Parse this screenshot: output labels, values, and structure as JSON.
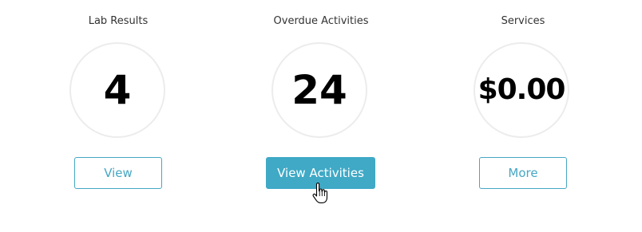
{
  "cards": [
    {
      "label": "Lab Results",
      "value": "4",
      "button_label": "View"
    },
    {
      "label": "Overdue Activities",
      "value": "24",
      "button_label": "View Activities"
    },
    {
      "label": "Services",
      "value": "$0.00",
      "button_label": "More"
    }
  ],
  "colors": {
    "accent": "#3fa9c6",
    "circle_border": "#ececec",
    "label_text": "#333333"
  },
  "icons": {
    "cursor": "hand-pointer-icon"
  }
}
